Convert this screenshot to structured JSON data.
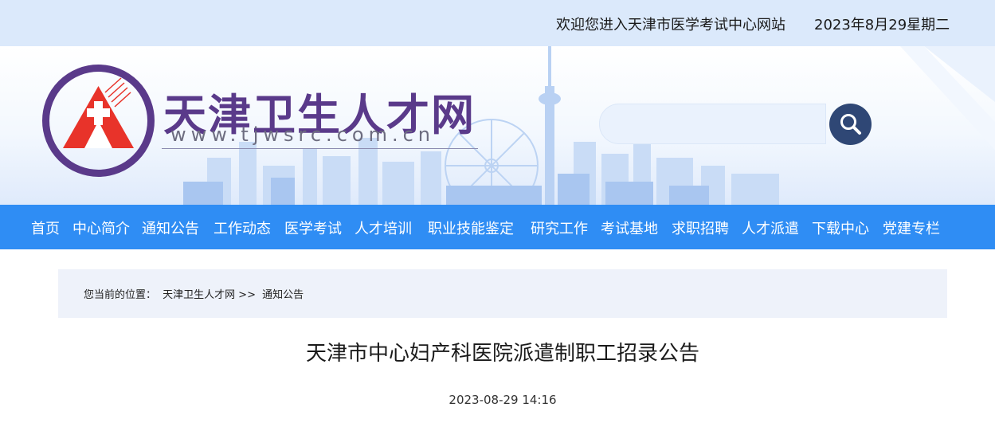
{
  "topbar": {
    "welcome": "欢迎您进入天津市医学考试中心网站",
    "date": "2023年8月29星期二"
  },
  "logo": {
    "title": "天津卫生人才网",
    "url": "www.tjwsrc.com.cn"
  },
  "search": {
    "placeholder": "",
    "icon": "search-icon"
  },
  "nav": {
    "items": [
      {
        "label": "首页"
      },
      {
        "label": "中心简介"
      },
      {
        "label": "通知公告"
      },
      {
        "label": "工作动态"
      },
      {
        "label": "医学考试"
      },
      {
        "label": "人才培训"
      },
      {
        "label": "职业技能鉴定"
      },
      {
        "label": "研究工作"
      },
      {
        "label": "考试基地"
      },
      {
        "label": "求职招聘"
      },
      {
        "label": "人才派遣"
      },
      {
        "label": "下载中心"
      },
      {
        "label": "党建专栏"
      }
    ]
  },
  "breadcrumb": {
    "prefix": "您当前的位置：",
    "home": "天津卫生人才网",
    "separator": ">>",
    "current": "通知公告"
  },
  "article": {
    "title": "天津市中心妇产科医院派遣制职工招录公告",
    "time": "2023-08-29 14:16"
  },
  "colors": {
    "nav_bg": "#2f8df4",
    "topbar_bg": "#dbe9fb",
    "brand_purple": "#5a3a8a",
    "emblem_red": "#e8332a"
  }
}
